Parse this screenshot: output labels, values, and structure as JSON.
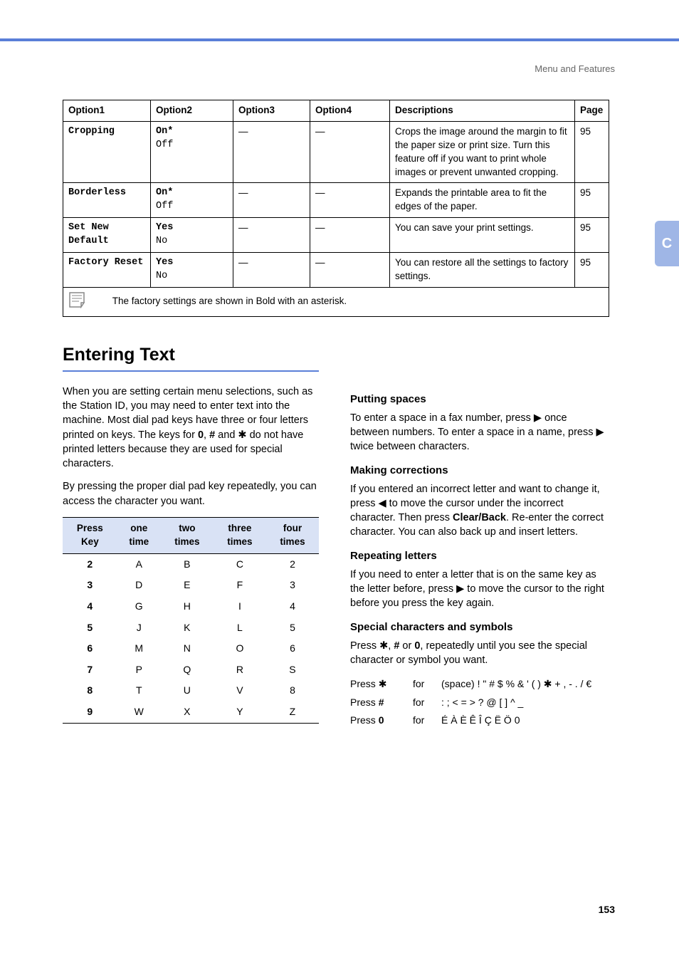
{
  "header": {
    "breadcrumb": "Menu and Features"
  },
  "side_tab": "C",
  "options_table": {
    "headers": [
      "Option1",
      "Option2",
      "Option3",
      "Option4",
      "Descriptions",
      "Page"
    ],
    "rows": [
      {
        "opt1": "Cropping",
        "opt2a": "On*",
        "opt2b": "Off",
        "opt3": "—",
        "opt4": "—",
        "desc": "Crops the image around the margin to fit the paper size or print size. Turn this feature off if you want to print whole images or prevent unwanted cropping.",
        "page": "95"
      },
      {
        "opt1": "Borderless",
        "opt2a": "On*",
        "opt2b": "Off",
        "opt3": "—",
        "opt4": "—",
        "desc": "Expands the printable area to fit the edges of the paper.",
        "page": "95"
      },
      {
        "opt1": "Set New Default",
        "opt2a": "Yes",
        "opt2b": "No",
        "opt3": "—",
        "opt4": "—",
        "desc": "You can save your print settings.",
        "page": "95"
      },
      {
        "opt1": "Factory Reset",
        "opt2a": "Yes",
        "opt2b": "No",
        "opt3": "—",
        "opt4": "—",
        "desc": "You can restore all the settings to factory settings.",
        "page": "95"
      }
    ],
    "footnote": "The factory settings are shown in Bold with an asterisk."
  },
  "section_title": "Entering Text",
  "left": {
    "para1a": "When you are setting certain menu selections, such as the Station ID, you may need to enter text into the machine. Most dial pad keys have three or four letters printed on keys. The keys for ",
    "bold0": "0",
    "comma": ", ",
    "boldhash": "#",
    "and": " and ",
    "star": "✱",
    "para1b": " do not have printed letters because they are used for special characters.",
    "para2": "By pressing the proper dial pad key repeatedly, you can access the character you want."
  },
  "keys_table": {
    "headers": [
      "Press Key",
      "one time",
      "two times",
      "three times",
      "four times"
    ],
    "rows": [
      [
        "2",
        "A",
        "B",
        "C",
        "2"
      ],
      [
        "3",
        "D",
        "E",
        "F",
        "3"
      ],
      [
        "4",
        "G",
        "H",
        "I",
        "4"
      ],
      [
        "5",
        "J",
        "K",
        "L",
        "5"
      ],
      [
        "6",
        "M",
        "N",
        "O",
        "6"
      ],
      [
        "7",
        "P",
        "Q",
        "R",
        "S"
      ],
      [
        "8",
        "T",
        "U",
        "V",
        "8"
      ],
      [
        "9",
        "W",
        "X",
        "Y",
        "Z"
      ]
    ]
  },
  "right": {
    "spaces_h": "Putting spaces",
    "spaces_p1": "To enter a space in a fax number, press ",
    "spaces_p2": " once between numbers. To enter a space in a name, press ",
    "spaces_p3": " twice between characters.",
    "arrow_right": "▶",
    "corr_h": "Making corrections",
    "corr_p1": "If you entered an incorrect letter and want to change it, press ",
    "arrow_left": "◀",
    "corr_p2": " to move the cursor under the incorrect character. Then press ",
    "clearback": "Clear/Back",
    "corr_p3": ". Re-enter the correct character. You can also back up and insert letters.",
    "rep_h": "Repeating letters",
    "rep_p1": "If you need to enter a letter that is on the same key as the letter before, press ",
    "rep_p2": " to move the cursor to the right before you press the key again.",
    "spec_h": "Special characters and symbols",
    "spec_p1a": "Press ",
    "spec_star": "✱",
    "spec_comma": ", ",
    "spec_hash": "#",
    "spec_or": " or ",
    "spec_zero": "0",
    "spec_p1b": ", repeatedly until you see the special character or symbol you want.",
    "rows": [
      {
        "label_a": "Press ",
        "key": "✱",
        "for": "for",
        "chars": "(space) ! \" # $ % & ' ( ) ✱ + , - . / €"
      },
      {
        "label_a": "Press ",
        "key": "#",
        "for": "for",
        "chars": ": ; < = > ? @ [ ] ^ _"
      },
      {
        "label_a": "Press ",
        "key": "0",
        "for": "for",
        "chars": "É À È Ê Î Ç Ë Ö 0"
      }
    ]
  },
  "page_number": "153"
}
